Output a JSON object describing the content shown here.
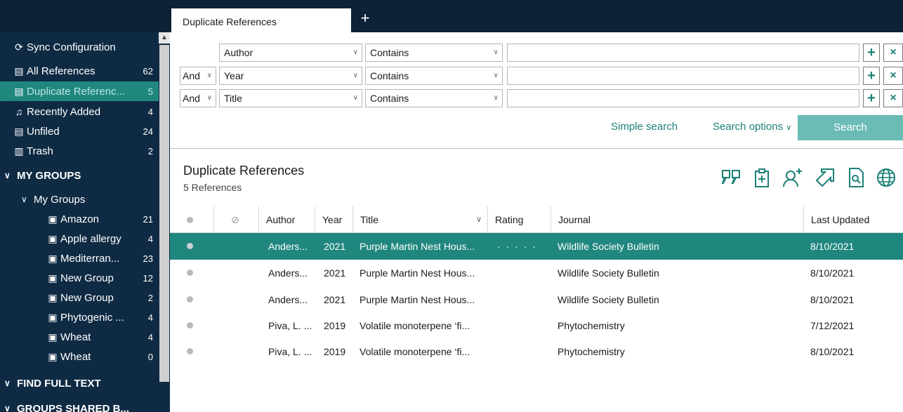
{
  "tab": {
    "active_label": "Duplicate References",
    "add_label": "+"
  },
  "sidebar": {
    "items": [
      {
        "label": "Sync Configuration",
        "icon": "sync-icon",
        "count": ""
      },
      {
        "label": "All References",
        "icon": "library-icon",
        "count": "62"
      },
      {
        "label": "Duplicate Referenc...",
        "icon": "duplicate-icon",
        "count": "5"
      },
      {
        "label": "Recently Added",
        "icon": "bell-icon",
        "count": "4"
      },
      {
        "label": "Unfiled",
        "icon": "library-icon",
        "count": "24"
      },
      {
        "label": "Trash",
        "icon": "trash-icon",
        "count": "2"
      }
    ],
    "my_groups_header": "MY GROUPS",
    "my_groups_sub": "My Groups",
    "groups": [
      {
        "label": "Amazon",
        "count": "21",
        "icon": "smart-group-icon"
      },
      {
        "label": "Apple allergy",
        "count": "4",
        "icon": "group-icon"
      },
      {
        "label": "Mediterran...",
        "count": "23",
        "icon": "group-icon"
      },
      {
        "label": "New Group",
        "count": "12",
        "icon": "group-icon"
      },
      {
        "label": "New Group",
        "count": "2",
        "icon": "group-icon"
      },
      {
        "label": "Phytogenic ...",
        "count": "4",
        "icon": "group-icon"
      },
      {
        "label": "Wheat",
        "count": "4",
        "icon": "smart-group-icon"
      },
      {
        "label": "Wheat",
        "count": "0",
        "icon": "smart-group-icon"
      }
    ],
    "find_full_text": "FIND FULL TEXT",
    "groups_shared": "GROUPS SHARED B..."
  },
  "search": {
    "rows": [
      {
        "conj": "",
        "field": "Author",
        "op": "Contains",
        "value": ""
      },
      {
        "conj": "And",
        "field": "Year",
        "op": "Contains",
        "value": ""
      },
      {
        "conj": "And",
        "field": "Title",
        "op": "Contains",
        "value": ""
      }
    ],
    "plus_label": "+",
    "x_label": "×",
    "simple_search": "Simple search",
    "search_options": "Search options",
    "search_button": "Search"
  },
  "group": {
    "title": "Duplicate References",
    "count": "5 References"
  },
  "table": {
    "headers": {
      "author": "Author",
      "year": "Year",
      "title": "Title",
      "rating": "Rating",
      "journal": "Journal",
      "updated": "Last Updated"
    },
    "rows": [
      {
        "author": "Anders...",
        "year": "2021",
        "title": "Purple Martin Nest Hous...",
        "rating": "· · · · ·",
        "journal": "Wildlife Society Bulletin",
        "updated": "8/10/2021"
      },
      {
        "author": "Anders...",
        "year": "2021",
        "title": "Purple Martin Nest Hous...",
        "rating": "",
        "journal": "Wildlife Society Bulletin",
        "updated": "8/10/2021"
      },
      {
        "author": "Anders...",
        "year": "2021",
        "title": "Purple Martin Nest Hous...",
        "rating": "",
        "journal": "Wildlife Society Bulletin",
        "updated": "8/10/2021"
      },
      {
        "author": "Piva, L. ...",
        "year": "2019",
        "title": "Volatile monoterpene ‘fi...",
        "rating": "",
        "journal": "Phytochemistry",
        "updated": "7/12/2021"
      },
      {
        "author": "Piva, L. ...",
        "year": "2019",
        "title": "Volatile monoterpene ‘fi...",
        "rating": "",
        "journal": "Phytochemistry",
        "updated": "8/10/2021"
      }
    ]
  },
  "colors": {
    "sidebar": "#0f2b44",
    "accent": "#20877f",
    "link": "#1b8077",
    "search_button": "#6bbcb5"
  }
}
